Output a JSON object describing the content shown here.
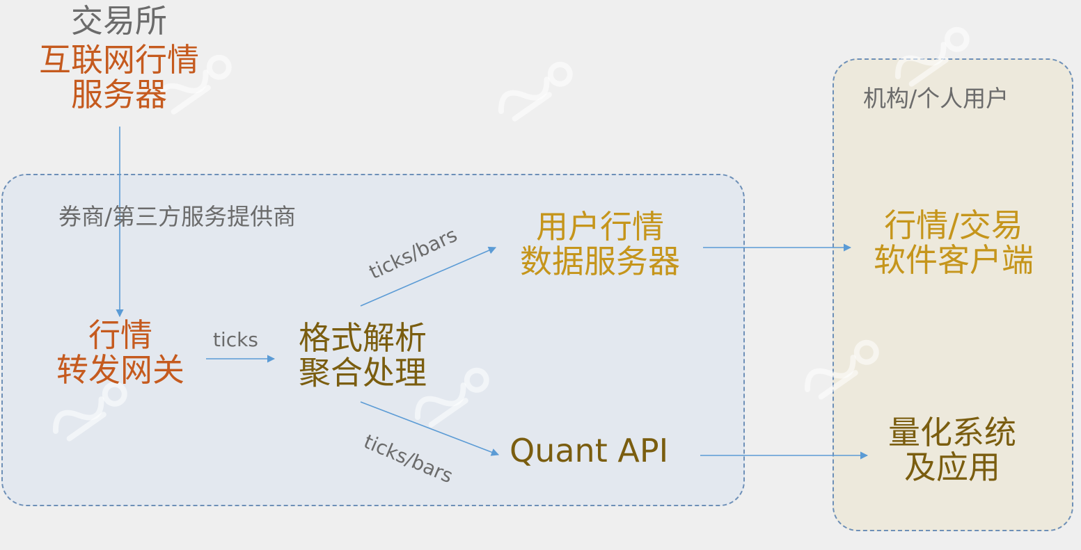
{
  "exchange": {
    "title": "交易所",
    "server": "互联网行情\n服务器"
  },
  "broker": {
    "label": "券商/第三方服务提供商",
    "gateway": "行情\n转发网关",
    "parser": "格式解析\n聚合处理",
    "user_server": "用户行情\n数据服务器",
    "quant_api": "Quant API"
  },
  "users": {
    "label": "机构/个人用户",
    "trade_client": "行情/交易\n软件客户端",
    "quant_app": "量化系统\n及应用"
  },
  "edges": {
    "gateway_to_parser": "ticks",
    "parser_to_user_server": "ticks/bars",
    "parser_to_quant_api": "ticks/bars"
  },
  "colors": {
    "arrow": "#5b9bd5",
    "box_border": "#6d8fb7",
    "broker_fill": "#e3e8ef",
    "user_fill": "#ede9dc",
    "orange": "#c55a1e",
    "gold": "#c5951b",
    "olive": "#7a5d0f",
    "gray": "#6b6b6b"
  }
}
